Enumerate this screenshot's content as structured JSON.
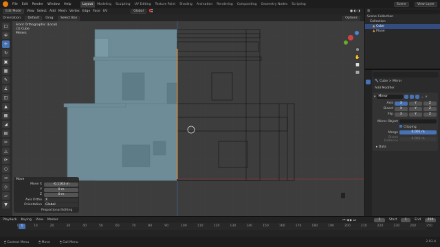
{
  "topbar": {
    "menus": [
      "File",
      "Edit",
      "Render",
      "Window",
      "Help"
    ],
    "workspaces": [
      "Layout",
      "Modeling",
      "Sculpting",
      "UV Editing",
      "Texture Paint",
      "Shading",
      "Animation",
      "Rendering",
      "Compositing",
      "Geometry Nodes",
      "Scripting"
    ],
    "scene": "Scene",
    "view_layer": "View Layer"
  },
  "header": {
    "mode": "Edit Mode",
    "menus": [
      "View",
      "Select",
      "Add",
      "Mesh",
      "Vertex",
      "Edge",
      "Face",
      "UV"
    ],
    "transform": "Global",
    "options": "Options"
  },
  "subheader": {
    "orientation_label": "Orientation:",
    "orientation": "Default",
    "drag_label": "Drag:",
    "drag": "Select Box"
  },
  "viewport": {
    "view_name": "Front Orthographic (Local)",
    "object": "(1) Cube",
    "units": "Meters"
  },
  "operator_panel": {
    "title": "Move",
    "move_x_label": "Move X",
    "move_x": "-0.1163 m",
    "y_label": "Y",
    "y": "0 m",
    "z_label": "Z",
    "z": "0 m",
    "axis_ortho_label": "Axis Ortho",
    "axis_ortho": "X",
    "orientation_label": "Orientation",
    "orientation": "Global",
    "proportional": "Proportional Editing"
  },
  "outliner": {
    "search_placeholder": "",
    "items": [
      {
        "label": "Scene Collection"
      },
      {
        "label": "Collection"
      },
      {
        "label": "Cube"
      },
      {
        "label": "Plane"
      }
    ]
  },
  "properties": {
    "breadcrumb_object": "Cube",
    "breadcrumb_modifier": "Mirror",
    "add_modifier": "Add Modifier",
    "modifier_name": "Mirror",
    "axis_label": "Axis",
    "bisect_label": "Bisect",
    "flip_label": "Flip",
    "axes": [
      "X",
      "Y",
      "Z"
    ],
    "mirror_object_label": "Mirror Object",
    "clipping_label": "Clipping",
    "merge_label": "Merge",
    "merge_value": "0.001 m",
    "bisect_distance_label": "Bisect Distance",
    "bisect_distance": "0.001 m",
    "data_label": "Data"
  },
  "timeline": {
    "menus": [
      "Playback",
      "Keying",
      "View",
      "Marker"
    ],
    "current_frame": "1",
    "start_label": "Start",
    "start": "1",
    "end_label": "End",
    "end": "250",
    "ticks": [
      "0",
      "10",
      "20",
      "30",
      "40",
      "50",
      "60",
      "70",
      "80",
      "90",
      "100",
      "110",
      "120",
      "130",
      "140",
      "150",
      "160",
      "170",
      "180",
      "190",
      "200",
      "210",
      "220",
      "230",
      "240",
      "250"
    ]
  },
  "status": {
    "hints": [
      "Context Menu",
      "Move",
      "Call Menu"
    ],
    "version": "2.93.4"
  }
}
